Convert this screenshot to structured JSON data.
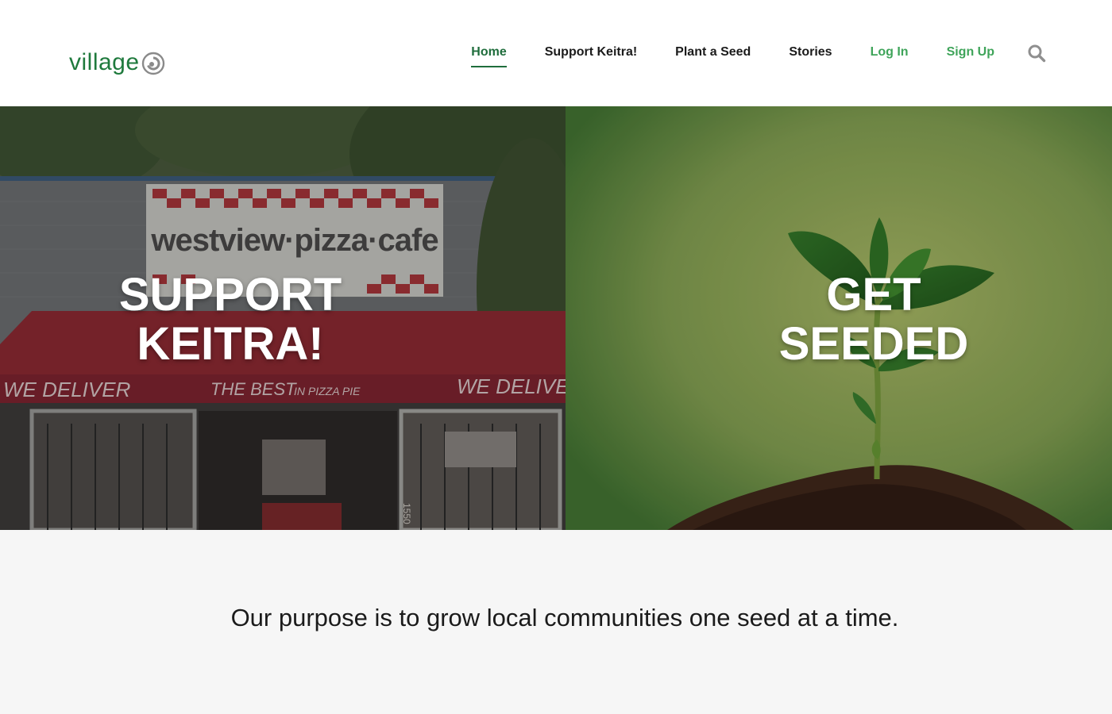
{
  "brand": {
    "name": "village",
    "color": "#1f7a3d",
    "mark_icon": "village-swirl-icon"
  },
  "nav": {
    "items": [
      {
        "label": "Home",
        "state": "active"
      },
      {
        "label": "Support Keitra!",
        "state": "default"
      },
      {
        "label": "Plant a Seed",
        "state": "default"
      },
      {
        "label": "Stories",
        "state": "default"
      },
      {
        "label": "Log In",
        "state": "accent"
      },
      {
        "label": "Sign Up",
        "state": "accent"
      }
    ],
    "search_icon": "search-icon",
    "active_color": "#1f6d3c",
    "accent_color": "#3fa45a"
  },
  "hero": {
    "left": {
      "title_line1": "SUPPORT",
      "title_line2": "KEITRA!",
      "sign_text": "westview·pizza·cafe",
      "awning_left": "WE DELIVER",
      "awning_center_a": "THE BEST",
      "awning_center_b": "IN PIZZA PIE",
      "awning_right": "WE DELIVE",
      "address_number": "1550"
    },
    "right": {
      "title_line1": "GET",
      "title_line2": "SEEDED"
    }
  },
  "purpose": {
    "text": "Our purpose is to grow local communities one seed at a time."
  }
}
